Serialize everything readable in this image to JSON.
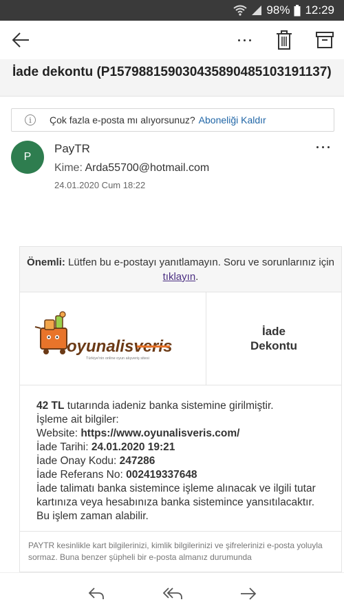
{
  "status": {
    "battery": "98%",
    "time": "12:29"
  },
  "subject": "İade dekontu (P15798815903043589048510319113​7)",
  "unsubscribe": {
    "text": "Çok fazla e-posta mı alıyorsunuz?",
    "link": "Aboneliği Kaldır"
  },
  "message": {
    "avatar_letter": "P",
    "sender": "PayTR",
    "to_label": "Kime:",
    "to_address": "Arda55700@hotmail.com",
    "date": "24.01.2020 Cum 18:22"
  },
  "email": {
    "notice_bold": "Önemli:",
    "notice_text": " Lütfen bu e-postayı yanıtlamayın. Soru ve sorunlarınız için ",
    "notice_link": "tıklayın",
    "notice_end": ".",
    "logo_text": "oyunalisveris",
    "logo_tagline": "Türkiye'nin online oyun alışveriş sitesi",
    "doc_title_1": "İade",
    "doc_title_2": "Dekontu",
    "amount": "42 TL",
    "amount_text": " tutarında iadeniz banka sistemine girilmiştir.",
    "info_label": "İşleme ait bilgiler:",
    "website_label": "Website: ",
    "website": "https://www.oyunalisveris.com/",
    "date_label": "İade Tarihi: ",
    "date_value": "24.01.2020 19:21",
    "approval_label": "İade Onay Kodu: ",
    "approval_value": "247286",
    "ref_label": "İade Referans No: ",
    "ref_value": "002419337648",
    "closing": "İade talimatı banka sistemince işleme alınacak ve ilgili tutar kartınıza veya hesabınıza banka sistemince yansıtılacaktır. Bu işlem zaman alabilir.",
    "footer": "PAYTR kesinlikle kart bilgilerinizi, kimlik bilgilerinizi ve şifrelerinizi e-posta yoluyla sormaz. Buna benzer şüpheli bir e-posta almanız durumunda"
  },
  "colors": {
    "avatar": "#2e7d4f",
    "link": "#1f65a6",
    "visited_link": "#4b2f82",
    "logo_orange": "#e8742a",
    "logo_brown": "#6b3a16"
  }
}
